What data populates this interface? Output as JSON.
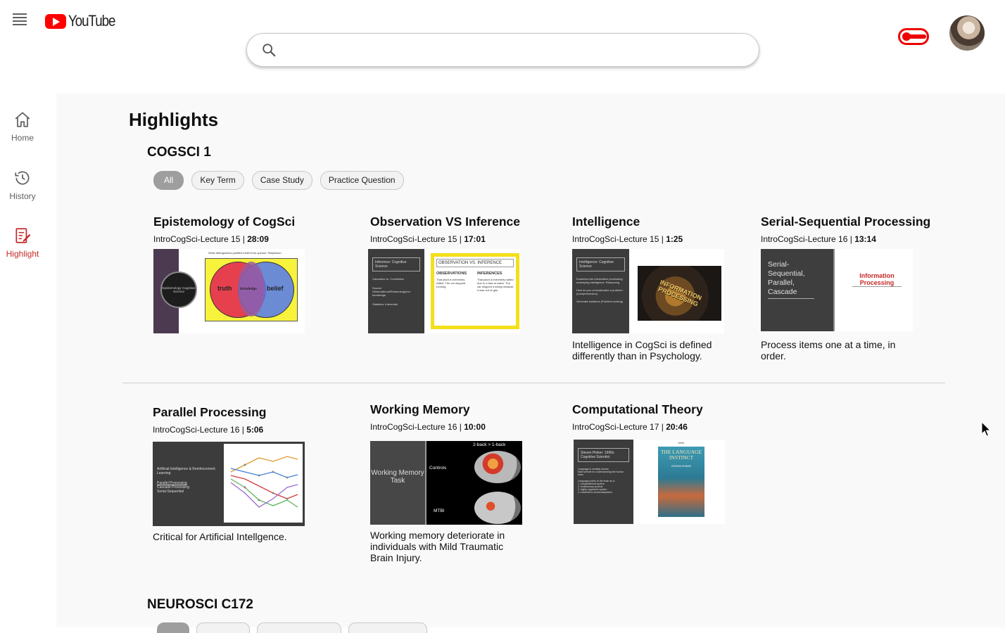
{
  "header": {
    "logo_text": "YouTube",
    "search_placeholder": "",
    "icons": {
      "menu": "menu-icon",
      "search": "search-icon",
      "toggle": "toggle-icon"
    }
  },
  "sidebar": {
    "items": [
      {
        "label": "Home",
        "icon": "home-icon"
      },
      {
        "label": "History",
        "icon": "history-icon"
      },
      {
        "label": "Highlight",
        "icon": "highlight-icon"
      }
    ],
    "active_color": "#c62828"
  },
  "page": {
    "title": "Highlights",
    "sections": [
      {
        "title": "COGSCI 1",
        "chips": [
          "All",
          "Key Term",
          "Case Study",
          "Practice Question"
        ],
        "cards": [
          {
            "title": "Epistemology of CogSci",
            "lecture": "IntroCogSci-Lecture 15 | ",
            "time": "28:09",
            "desc": "",
            "thumb": {
              "caption": "What distinguishes justified belief from opinion: Skepticism",
              "circle": "Epistemology Cognitive Science",
              "left": "truth",
              "mid": "knowledge",
              "right": "belief"
            }
          },
          {
            "title": "Observation VS Inference",
            "lecture": "IntroCogSci-Lecture 15 | ",
            "time": "17:01",
            "desc": "",
            "thumb": {
              "box": "Inference: Cognitive Science",
              "lines": [
                "Causation vs. Correlation",
                "Source: Observational/Reasoning/prior knowledge",
                "Statistics: Inferential"
              ],
              "heading": "OBSERVATION VS. INFERENCE",
              "col1": "OBSERVATIONS",
              "col2": "INFERENCES",
              "col1_text": "That plant is extremely wilted. The car stopped running.",
              "col2_text": "That plant is extremely wilted due to a lack of water. The car stopped running because it was out of gas."
            }
          },
          {
            "title": "Intelligence",
            "lecture": "IntroCogSci-Lecture 15 | ",
            "time": "1:25",
            "desc": "Intelligence in CogSci is defined differently than in Psychology.",
            "thumb": {
              "box": "Intelligence: Cognitive Science",
              "lines": [
                "Examines the information processing underlying intelligence: Reasoning",
                "How do you conceptualize a problem (comprehension)",
                "Generate solutions (Problem-solving)"
              ],
              "image": "INFORMATION PROCESSING"
            }
          },
          {
            "title": "Serial-Sequential Processing",
            "lecture": "IntroCogSci-Lecture 16 | ",
            "time": "13:14",
            "desc": "Process items one at a time, in order.",
            "thumb": {
              "text": "Serial-Sequential, Parallel, Cascade",
              "right": "Information Processing"
            }
          },
          {
            "title": "Parallel Processing",
            "lecture": "IntroCogSci-Lecture 16 | ",
            "time": "5:06",
            "desc": "Critical for Artificial Intellgence.",
            "thumb": {
              "text": "Artificial Intelligence & Reinforcement Learning",
              "lines": [
                "Parallel Processing",
                "Cascade Processing",
                "Serial-Sequential"
              ]
            }
          },
          {
            "title": "Working Memory",
            "lecture": "IntroCogSci-Lecture 16 | ",
            "time": "10:00",
            "desc": "Working memory deteriorate in individuals with Mild Traumatic Brain Injury.",
            "thumb": {
              "text": "Working Memory Task",
              "top": "2-back > 1-back",
              "a": "Controls",
              "b": "MTBI"
            }
          },
          {
            "title": "Computational Theory",
            "lecture": "IntroCogSci-Lecture 17 | ",
            "time": "20:46",
            "desc": "",
            "thumb": {
              "box": "Steven Pinker: 1990s Cognitive Scientist",
              "lines": [
                "Language is innately human",
                "Main vehicle for understanding the human brain",
                "Language points to the brain as a:",
                "1. computational system",
                "2. evolutionary product",
                "3. highly organized system",
                "4. essential to social adaptation"
              ],
              "book": "THE LANGUAGE INSTINCT",
              "book_author": "STEVEN PINKER",
              "year": "1994"
            }
          }
        ]
      },
      {
        "title": "NEUROSCI C172"
      }
    ]
  }
}
